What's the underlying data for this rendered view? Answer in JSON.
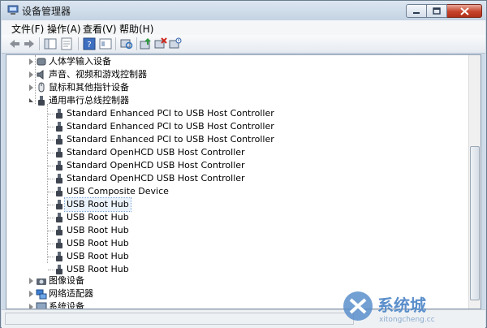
{
  "window": {
    "title": "设备管理器"
  },
  "caption": {
    "minimize_icon": "minimize-icon",
    "maximize_icon": "maximize-icon",
    "close_icon": "close-icon"
  },
  "menu": [
    {
      "label": "文件(F)"
    },
    {
      "label": "操作(A)"
    },
    {
      "label": "查看(V)"
    },
    {
      "label": "帮助(H)"
    }
  ],
  "toolbar": {
    "icons": [
      "back-icon",
      "forward-icon",
      "show-hide-console-tree-icon",
      "properties-icon",
      "help-icon",
      "view-icon",
      "scan-hardware-icon",
      "update-driver-icon",
      "uninstall-icon",
      "disable-icon"
    ]
  },
  "tree": {
    "categories_before": [
      {
        "label": "人体学输入设备",
        "icon": "hid-icon"
      },
      {
        "label": "声音、视频和游戏控制器",
        "icon": "sound-icon"
      },
      {
        "label": "鼠标和其他指针设备",
        "icon": "mouse-icon"
      }
    ],
    "expanded_category": {
      "label": "通用串行总线控制器",
      "icon": "usb-icon"
    },
    "usb_devices": [
      "Standard Enhanced PCI to USB Host Controller",
      "Standard Enhanced PCI to USB Host Controller",
      "Standard Enhanced PCI to USB Host Controller",
      "Standard OpenHCD USB Host Controller",
      "Standard OpenHCD USB Host Controller",
      "Standard OpenHCD USB Host Controller",
      "USB Composite Device",
      "USB Root Hub",
      "USB Root Hub",
      "USB Root Hub",
      "USB Root Hub",
      "USB Root Hub",
      "USB Root Hub"
    ],
    "selected_device": "USB Root Hub",
    "categories_after": [
      {
        "label": "图像设备",
        "icon": "imaging-icon"
      },
      {
        "label": "网络适配器",
        "icon": "network-icon"
      },
      {
        "label": "系统设备",
        "icon": "system-icon"
      }
    ]
  },
  "watermark": {
    "text": "系统城",
    "subtext": "xitongcheng.cc"
  },
  "colors": {
    "title_bg": "#cfdbe8",
    "close_btn": "#c7432b",
    "selection": "#eaf2fb"
  }
}
